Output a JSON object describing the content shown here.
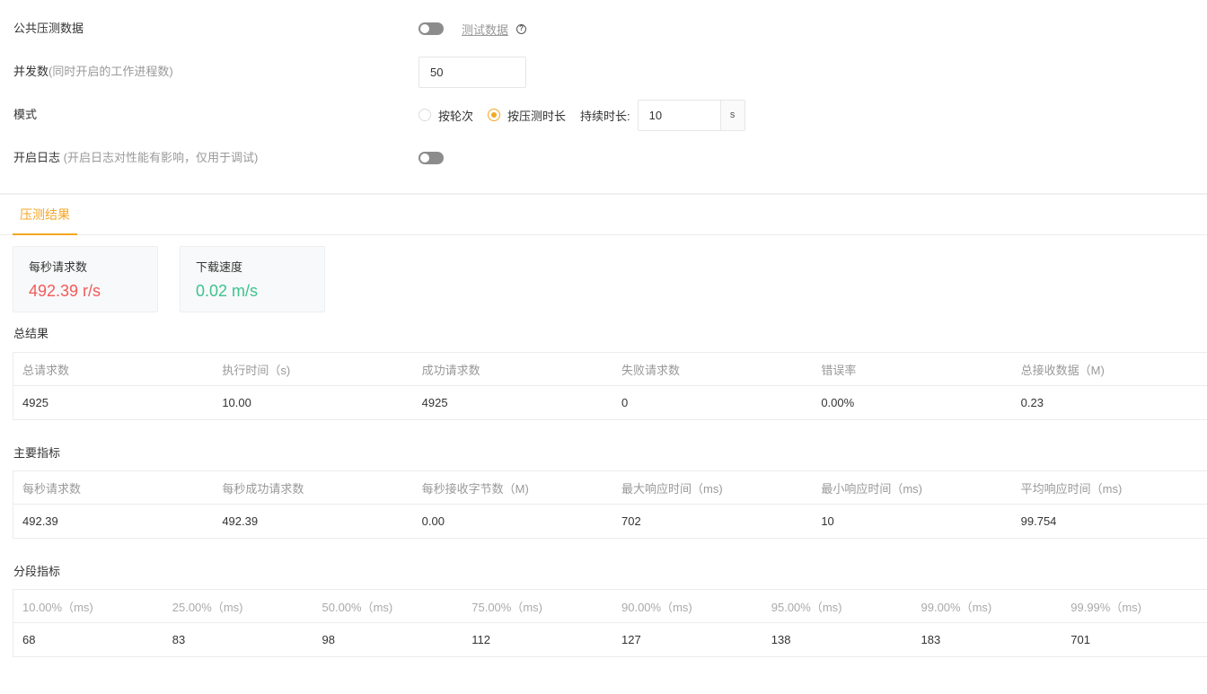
{
  "form": {
    "public_data": {
      "label": "公共压测数据",
      "link": "测试数据",
      "help_icon": "question-circle-icon"
    },
    "concurrency": {
      "label": "并发数",
      "hint": "(同时开启的工作进程数)",
      "value": "50"
    },
    "mode": {
      "label": "模式",
      "option_rounds": "按轮次",
      "option_duration": "按压测时长",
      "selected": "按压测时长",
      "duration_label": "持续时长:",
      "duration_value": "10",
      "duration_unit": "s"
    },
    "logging": {
      "label": "开启日志",
      "hint": "(开启日志对性能有影响，仅用于调试)"
    }
  },
  "tabs": {
    "results": "压测结果"
  },
  "cards": {
    "rps": {
      "title": "每秒请求数",
      "value": "492.39 r/s",
      "color": "#f25a5a"
    },
    "download": {
      "title": "下载速度",
      "value": "0.02 m/s",
      "color": "#3ec28f"
    }
  },
  "summary": {
    "title": "总结果",
    "headers": [
      "总请求数",
      "执行时间（s)",
      "成功请求数",
      "失败请求数",
      "错误率",
      "总接收数据（M)"
    ],
    "values": [
      "4925",
      "10.00",
      "4925",
      "0",
      "0.00%",
      "0.23"
    ]
  },
  "metrics": {
    "title": "主要指标",
    "headers": [
      "每秒请求数",
      "每秒成功请求数",
      "每秒接收字节数（M)",
      "最大响应时间（ms)",
      "最小响应时间（ms)",
      "平均响应时间（ms)"
    ],
    "values": [
      "492.39",
      "492.39",
      "0.00",
      "702",
      "10",
      "99.754"
    ]
  },
  "percentiles": {
    "title": "分段指标",
    "headers": [
      "10.00%（ms)",
      "25.00%（ms)",
      "50.00%（ms)",
      "75.00%（ms)",
      "90.00%（ms)",
      "95.00%（ms)",
      "99.00%（ms)",
      "99.99%（ms)"
    ],
    "values": [
      "68",
      "83",
      "98",
      "112",
      "127",
      "138",
      "183",
      "701"
    ]
  },
  "accent_color": "#f5a623"
}
